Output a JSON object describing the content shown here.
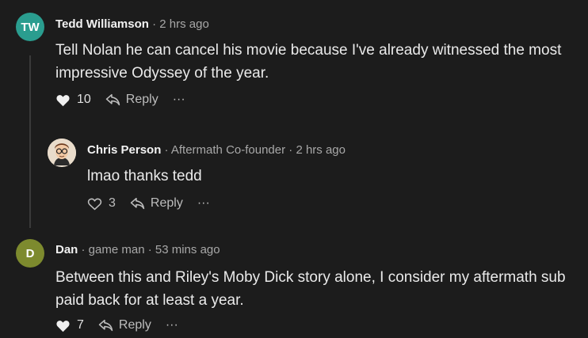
{
  "comments": [
    {
      "initials": "TW",
      "avatar_color": "#2a9d8f",
      "author": "Tedd Williamson",
      "meta": " · 2 hrs ago",
      "text_lines": [
        "Tell Nolan he can cancel his movie because I've already witnessed the most",
        "impressive Odyssey of the year."
      ],
      "likes": "10",
      "liked": true,
      "reply_label": "Reply",
      "more": "···"
    },
    {
      "avatar_icon": "person-glasses-illustration",
      "author": "Chris Person",
      "meta": " · Aftermath Co-founder · 2 hrs ago",
      "text_lines": [
        "lmao thanks tedd"
      ],
      "likes": "3",
      "liked": false,
      "reply_label": "Reply",
      "more": "···"
    },
    {
      "initials": "D",
      "avatar_color": "#7d8a2e",
      "author": "Dan",
      "meta": " · game man · 53 mins ago",
      "text_lines": [
        "Between this and Riley's Moby Dick story alone, I consider my aftermath sub",
        "paid back for at least a year."
      ],
      "likes": "7",
      "liked": true,
      "reply_label": "Reply",
      "more": "···"
    }
  ]
}
